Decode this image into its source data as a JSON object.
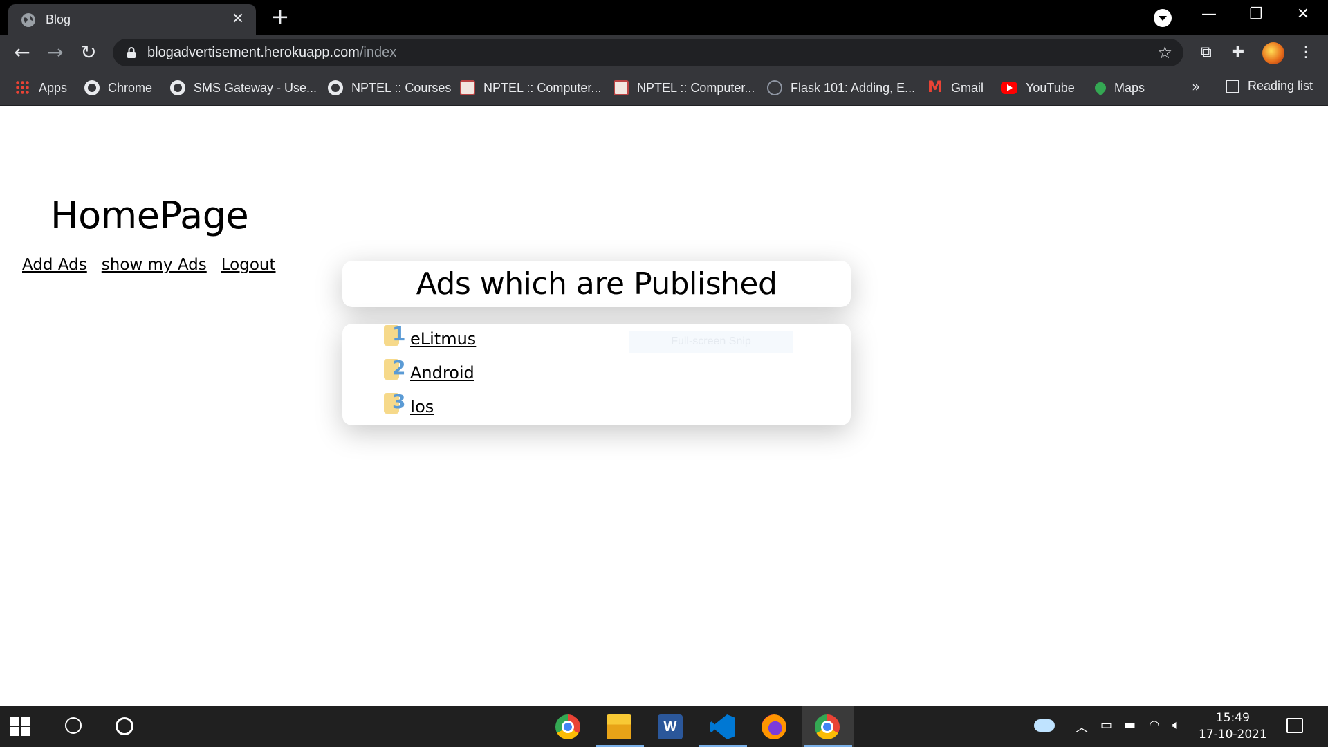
{
  "browser": {
    "tab_title": "Blog",
    "tab_close": "✕",
    "new_tab": "+",
    "url_host": "blogadvertisement.herokuapp.com",
    "url_path": "/index",
    "window_controls": [
      "—",
      "❐",
      "✕"
    ],
    "bookmarks": [
      {
        "label": "Apps",
        "icon": "apps-grid-icon"
      },
      {
        "label": "Chrome",
        "icon": "globe-icon"
      },
      {
        "label": "SMS Gateway - Use...",
        "icon": "globe-icon"
      },
      {
        "label": "NPTEL :: Courses",
        "icon": "globe-icon"
      },
      {
        "label": "NPTEL :: Computer...",
        "icon": "nptel-icon"
      },
      {
        "label": "NPTEL :: Computer...",
        "icon": "nptel-icon"
      },
      {
        "label": "Flask 101: Adding, E...",
        "icon": "flask-icon"
      },
      {
        "label": "Gmail",
        "icon": "gmail-icon"
      },
      {
        "label": "YouTube",
        "icon": "youtube-icon"
      },
      {
        "label": "Maps",
        "icon": "maps-icon"
      }
    ],
    "bookmarks_overflow": "»",
    "reading_list": "Reading list"
  },
  "page": {
    "title": "HomePage",
    "nav": [
      "Add Ads",
      "show my Ads",
      "Logout"
    ],
    "ads_heading": "Ads which are Published",
    "ads": [
      {
        "num": "1",
        "label": "eLitmus"
      },
      {
        "num": "2",
        "label": "Android"
      },
      {
        "num": "3",
        "label": "Ios"
      }
    ],
    "snip_overlay": "Full-screen Snip"
  },
  "taskbar": {
    "apps": [
      "chrome-icon",
      "file-explorer-icon",
      "word-icon",
      "vscode-icon",
      "firefox-icon",
      "chrome-icon"
    ],
    "time": "15:49",
    "date": "17-10-2021"
  }
}
